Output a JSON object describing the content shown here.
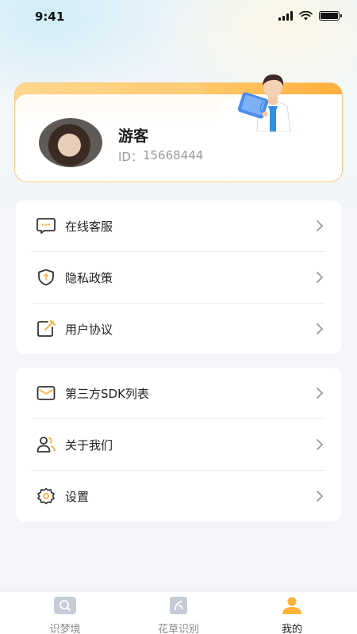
{
  "status_bar": {
    "time": "9:41"
  },
  "profile": {
    "nickname": "游客",
    "id_label": "ID：",
    "id_value": "15668444"
  },
  "menu_group_1": [
    {
      "label": "在线客服",
      "icon": "chat-bubble-icon"
    },
    {
      "label": "隐私政策",
      "icon": "shield-icon"
    },
    {
      "label": "用户协议",
      "icon": "edit-document-icon"
    }
  ],
  "menu_group_2": [
    {
      "label": "第三方SDK列表",
      "icon": "mail-icon"
    },
    {
      "label": "关于我们",
      "icon": "users-icon"
    },
    {
      "label": "设置",
      "icon": "gear-icon"
    }
  ],
  "tab_bar": {
    "tabs": [
      {
        "label": "识梦境",
        "icon": "dream-search-icon"
      },
      {
        "label": "花草识别",
        "icon": "plant-recognition-icon"
      },
      {
        "label": "我的",
        "icon": "profile-icon"
      }
    ],
    "active_index": 2
  },
  "colors": {
    "accent": "#ffb23a",
    "tab_inactive_icon": "#c7cbd6",
    "icon_stroke": "#333333"
  }
}
